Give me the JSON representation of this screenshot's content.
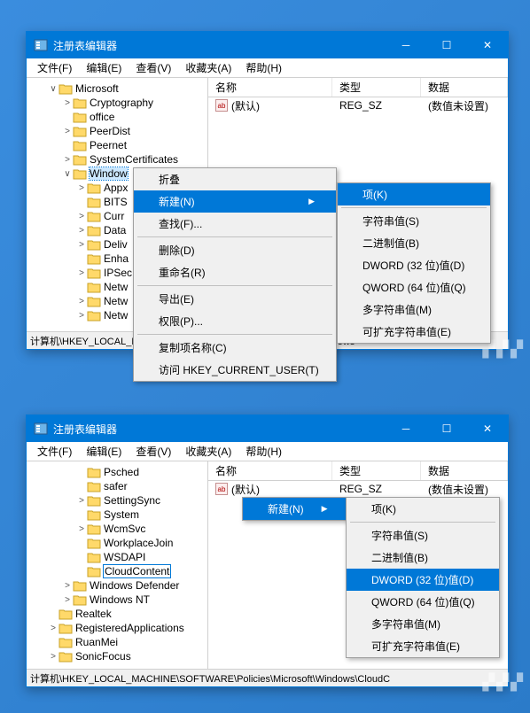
{
  "window1": {
    "title": "注册表编辑器",
    "menubar": [
      "文件(F)",
      "编辑(E)",
      "查看(V)",
      "收藏夹(A)",
      "帮助(H)"
    ],
    "tree": [
      {
        "d": 1,
        "disc": "∨",
        "label": "Microsoft"
      },
      {
        "d": 2,
        "disc": ">",
        "label": "Cryptography"
      },
      {
        "d": 2,
        "disc": "",
        "label": "office"
      },
      {
        "d": 2,
        "disc": ">",
        "label": "PeerDist"
      },
      {
        "d": 2,
        "disc": "",
        "label": "Peernet"
      },
      {
        "d": 2,
        "disc": ">",
        "label": "SystemCertificates"
      },
      {
        "d": 2,
        "disc": "∨",
        "label": "Window",
        "sel": true
      },
      {
        "d": 3,
        "disc": ">",
        "label": "Appx"
      },
      {
        "d": 3,
        "disc": "",
        "label": "BITS"
      },
      {
        "d": 3,
        "disc": ">",
        "label": "Curr"
      },
      {
        "d": 3,
        "disc": ">",
        "label": "Data"
      },
      {
        "d": 3,
        "disc": ">",
        "label": "Deliv"
      },
      {
        "d": 3,
        "disc": "",
        "label": "Enha"
      },
      {
        "d": 3,
        "disc": ">",
        "label": "IPSec"
      },
      {
        "d": 3,
        "disc": "",
        "label": "Netw"
      },
      {
        "d": 3,
        "disc": ">",
        "label": "Netw"
      },
      {
        "d": 3,
        "disc": ">",
        "label": "Netw"
      }
    ],
    "listhead": {
      "name": "名称",
      "type": "类型",
      "data": "数据"
    },
    "listrow": {
      "name": "(默认)",
      "type": "REG_SZ",
      "data": "(数值未设置)"
    },
    "statusbar": "计算机\\HKEY_LOCAL_MACHINE\\SOFTWARE\\Policies\\Microsoft\\Windows",
    "ctxmenu": {
      "items": [
        {
          "label": "折叠"
        },
        {
          "label": "新建(N)",
          "arrow": true,
          "highlight": true
        },
        {
          "label": "查找(F)..."
        },
        {
          "sep": true
        },
        {
          "label": "删除(D)"
        },
        {
          "label": "重命名(R)"
        },
        {
          "sep": true
        },
        {
          "label": "导出(E)"
        },
        {
          "label": "权限(P)..."
        },
        {
          "sep": true
        },
        {
          "label": "复制项名称(C)"
        },
        {
          "label": "访问 HKEY_CURRENT_USER(T)"
        }
      ]
    },
    "submenu": {
      "items": [
        {
          "label": "项(K)",
          "highlight": true
        },
        {
          "sep": true
        },
        {
          "label": "字符串值(S)"
        },
        {
          "label": "二进制值(B)"
        },
        {
          "label": "DWORD (32 位)值(D)"
        },
        {
          "label": "QWORD (64 位)值(Q)"
        },
        {
          "label": "多字符串值(M)"
        },
        {
          "label": "可扩充字符串值(E)"
        }
      ]
    }
  },
  "window2": {
    "title": "注册表编辑器",
    "menubar": [
      "文件(F)",
      "编辑(E)",
      "查看(V)",
      "收藏夹(A)",
      "帮助(H)"
    ],
    "tree": [
      {
        "d": 3,
        "disc": "",
        "label": "Psched"
      },
      {
        "d": 3,
        "disc": "",
        "label": "safer"
      },
      {
        "d": 3,
        "disc": ">",
        "label": "SettingSync"
      },
      {
        "d": 3,
        "disc": "",
        "label": "System"
      },
      {
        "d": 3,
        "disc": ">",
        "label": "WcmSvc"
      },
      {
        "d": 3,
        "disc": "",
        "label": "WorkplaceJoin"
      },
      {
        "d": 3,
        "disc": "",
        "label": "WSDAPI"
      },
      {
        "d": 3,
        "disc": "",
        "label": "CloudContent",
        "box": true
      },
      {
        "d": 2,
        "disc": ">",
        "label": "Windows Defender"
      },
      {
        "d": 2,
        "disc": ">",
        "label": "Windows NT"
      },
      {
        "d": 1,
        "disc": "",
        "label": "Realtek"
      },
      {
        "d": 1,
        "disc": ">",
        "label": "RegisteredApplications"
      },
      {
        "d": 1,
        "disc": "",
        "label": "RuanMei"
      },
      {
        "d": 1,
        "disc": ">",
        "label": "SonicFocus"
      }
    ],
    "listhead": {
      "name": "名称",
      "type": "类型",
      "data": "数据"
    },
    "listrow": {
      "name": "(默认)",
      "type": "REG_SZ",
      "data": "(数值未设置)"
    },
    "statusbar": "计算机\\HKEY_LOCAL_MACHINE\\SOFTWARE\\Policies\\Microsoft\\Windows\\CloudC",
    "ctxmenu": {
      "items": [
        {
          "label": "新建(N)",
          "arrow": true,
          "highlight": true
        }
      ]
    },
    "submenu": {
      "items": [
        {
          "label": "项(K)"
        },
        {
          "sep": true
        },
        {
          "label": "字符串值(S)"
        },
        {
          "label": "二进制值(B)"
        },
        {
          "label": "DWORD (32 位)值(D)",
          "highlight": true
        },
        {
          "label": "QWORD (64 位)值(Q)"
        },
        {
          "label": "多字符串值(M)"
        },
        {
          "label": "可扩充字符串值(E)"
        }
      ]
    }
  }
}
